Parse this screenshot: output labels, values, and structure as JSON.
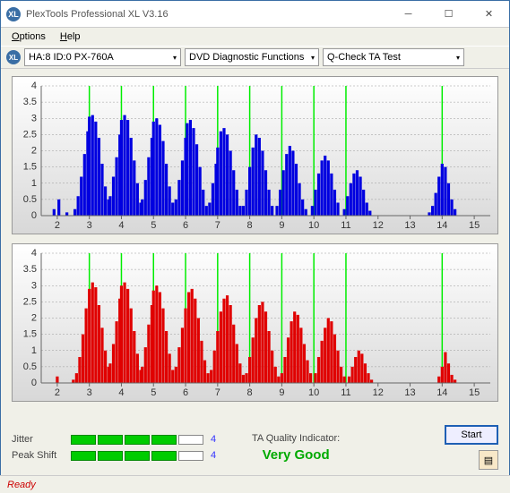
{
  "window": {
    "title": "PlexTools Professional XL V3.16",
    "icon_label": "XL"
  },
  "menu": {
    "options": "Options",
    "help": "Help"
  },
  "toolbar": {
    "device": "HA:8 ID:0   PX-760A",
    "func": "DVD Diagnostic Functions",
    "test": "Q-Check TA Test"
  },
  "metrics": {
    "jitter_label": "Jitter",
    "jitter_value": "4",
    "jitter_bars_filled": 4,
    "peakshift_label": "Peak Shift",
    "peakshift_value": "4",
    "peakshift_bars_filled": 4,
    "ta_label": "TA Quality Indicator:",
    "ta_value": "Very Good"
  },
  "buttons": {
    "start": "Start"
  },
  "status": "Ready",
  "chart_data": [
    {
      "type": "bar",
      "title": "",
      "xlabel": "",
      "ylabel": "",
      "ylim": [
        0,
        4
      ],
      "yticks": [
        0,
        0.5,
        1,
        1.5,
        2,
        2.5,
        3,
        3.5,
        4
      ],
      "xlim": [
        1.5,
        15.5
      ],
      "xticks": [
        2,
        3,
        4,
        5,
        6,
        7,
        8,
        9,
        10,
        11,
        12,
        13,
        14,
        15
      ],
      "vlines": [
        3,
        4,
        5,
        6,
        7,
        8,
        9,
        10,
        11,
        14
      ],
      "color": "#0000e0",
      "points": [
        [
          1.9,
          0.2
        ],
        [
          2.05,
          0.5
        ],
        [
          2.3,
          0.1
        ],
        [
          2.55,
          0.2
        ],
        [
          2.65,
          0.6
        ],
        [
          2.75,
          1.2
        ],
        [
          2.85,
          1.9
        ],
        [
          2.95,
          2.6
        ],
        [
          3.0,
          3.05
        ],
        [
          3.1,
          3.1
        ],
        [
          3.2,
          2.9
        ],
        [
          3.3,
          2.4
        ],
        [
          3.4,
          1.6
        ],
        [
          3.5,
          0.9
        ],
        [
          3.6,
          0.5
        ],
        [
          3.65,
          0.6
        ],
        [
          3.75,
          1.2
        ],
        [
          3.85,
          1.8
        ],
        [
          3.95,
          2.5
        ],
        [
          4.0,
          2.95
        ],
        [
          4.1,
          3.1
        ],
        [
          4.2,
          2.95
        ],
        [
          4.3,
          2.4
        ],
        [
          4.4,
          1.7
        ],
        [
          4.5,
          1.0
        ],
        [
          4.6,
          0.4
        ],
        [
          4.65,
          0.5
        ],
        [
          4.75,
          1.1
        ],
        [
          4.85,
          1.8
        ],
        [
          4.95,
          2.4
        ],
        [
          5.0,
          2.9
        ],
        [
          5.1,
          3.0
        ],
        [
          5.2,
          2.8
        ],
        [
          5.3,
          2.3
        ],
        [
          5.4,
          1.6
        ],
        [
          5.5,
          0.9
        ],
        [
          5.6,
          0.4
        ],
        [
          5.7,
          0.5
        ],
        [
          5.8,
          1.1
        ],
        [
          5.9,
          1.7
        ],
        [
          6.0,
          2.4
        ],
        [
          6.05,
          2.85
        ],
        [
          6.15,
          2.95
        ],
        [
          6.25,
          2.7
        ],
        [
          6.35,
          2.2
        ],
        [
          6.45,
          1.5
        ],
        [
          6.55,
          0.8
        ],
        [
          6.65,
          0.3
        ],
        [
          6.75,
          0.4
        ],
        [
          6.85,
          1.0
        ],
        [
          6.95,
          1.6
        ],
        [
          7.0,
          2.1
        ],
        [
          7.1,
          2.6
        ],
        [
          7.2,
          2.7
        ],
        [
          7.3,
          2.5
        ],
        [
          7.4,
          2.0
        ],
        [
          7.5,
          1.4
        ],
        [
          7.6,
          0.8
        ],
        [
          7.7,
          0.3
        ],
        [
          7.8,
          0.3
        ],
        [
          7.9,
          0.8
        ],
        [
          8.0,
          1.5
        ],
        [
          8.1,
          2.1
        ],
        [
          8.2,
          2.5
        ],
        [
          8.3,
          2.4
        ],
        [
          8.4,
          2.0
        ],
        [
          8.5,
          1.4
        ],
        [
          8.6,
          0.8
        ],
        [
          8.7,
          0.3
        ],
        [
          8.85,
          0.3
        ],
        [
          8.95,
          0.8
        ],
        [
          9.05,
          1.4
        ],
        [
          9.15,
          1.9
        ],
        [
          9.25,
          2.15
        ],
        [
          9.35,
          2.0
        ],
        [
          9.45,
          1.6
        ],
        [
          9.55,
          1.0
        ],
        [
          9.65,
          0.5
        ],
        [
          9.75,
          0.2
        ],
        [
          9.95,
          0.3
        ],
        [
          10.05,
          0.8
        ],
        [
          10.15,
          1.3
        ],
        [
          10.25,
          1.7
        ],
        [
          10.35,
          1.85
        ],
        [
          10.45,
          1.7
        ],
        [
          10.55,
          1.3
        ],
        [
          10.65,
          0.8
        ],
        [
          10.75,
          0.4
        ],
        [
          10.95,
          0.2
        ],
        [
          11.05,
          0.6
        ],
        [
          11.15,
          1.0
        ],
        [
          11.25,
          1.3
        ],
        [
          11.35,
          1.4
        ],
        [
          11.45,
          1.2
        ],
        [
          11.55,
          0.8
        ],
        [
          11.65,
          0.4
        ],
        [
          11.75,
          0.15
        ],
        [
          13.6,
          0.1
        ],
        [
          13.7,
          0.3
        ],
        [
          13.8,
          0.7
        ],
        [
          13.9,
          1.2
        ],
        [
          14.0,
          1.6
        ],
        [
          14.1,
          1.5
        ],
        [
          14.2,
          1.0
        ],
        [
          14.3,
          0.5
        ],
        [
          14.4,
          0.2
        ]
      ]
    },
    {
      "type": "bar",
      "title": "",
      "xlabel": "",
      "ylabel": "",
      "ylim": [
        0,
        4
      ],
      "yticks": [
        0,
        0.5,
        1,
        1.5,
        2,
        2.5,
        3,
        3.5,
        4
      ],
      "xlim": [
        1.5,
        15.5
      ],
      "xticks": [
        2,
        3,
        4,
        5,
        6,
        7,
        8,
        9,
        10,
        11,
        12,
        13,
        14,
        15
      ],
      "vlines": [
        3,
        4,
        5,
        6,
        7,
        8,
        9,
        10,
        11,
        14
      ],
      "color": "#e00000",
      "points": [
        [
          2.0,
          0.2
        ],
        [
          2.5,
          0.1
        ],
        [
          2.6,
          0.3
        ],
        [
          2.7,
          0.8
        ],
        [
          2.8,
          1.5
        ],
        [
          2.9,
          2.3
        ],
        [
          3.0,
          2.9
        ],
        [
          3.1,
          3.1
        ],
        [
          3.2,
          2.95
        ],
        [
          3.3,
          2.4
        ],
        [
          3.4,
          1.7
        ],
        [
          3.5,
          1.0
        ],
        [
          3.6,
          0.5
        ],
        [
          3.65,
          0.6
        ],
        [
          3.75,
          1.2
        ],
        [
          3.85,
          1.9
        ],
        [
          3.95,
          2.6
        ],
        [
          4.0,
          3.0
        ],
        [
          4.1,
          3.1
        ],
        [
          4.2,
          2.9
        ],
        [
          4.3,
          2.3
        ],
        [
          4.4,
          1.6
        ],
        [
          4.5,
          0.9
        ],
        [
          4.6,
          0.4
        ],
        [
          4.65,
          0.5
        ],
        [
          4.75,
          1.1
        ],
        [
          4.85,
          1.8
        ],
        [
          4.95,
          2.4
        ],
        [
          5.0,
          2.85
        ],
        [
          5.1,
          3.0
        ],
        [
          5.2,
          2.8
        ],
        [
          5.3,
          2.3
        ],
        [
          5.4,
          1.6
        ],
        [
          5.5,
          0.9
        ],
        [
          5.6,
          0.4
        ],
        [
          5.7,
          0.5
        ],
        [
          5.8,
          1.1
        ],
        [
          5.9,
          1.7
        ],
        [
          6.0,
          2.3
        ],
        [
          6.1,
          2.8
        ],
        [
          6.2,
          2.9
        ],
        [
          6.3,
          2.6
        ],
        [
          6.4,
          2.0
        ],
        [
          6.5,
          1.3
        ],
        [
          6.6,
          0.7
        ],
        [
          6.7,
          0.3
        ],
        [
          6.8,
          0.4
        ],
        [
          6.9,
          1.0
        ],
        [
          7.0,
          1.6
        ],
        [
          7.1,
          2.2
        ],
        [
          7.2,
          2.6
        ],
        [
          7.3,
          2.7
        ],
        [
          7.4,
          2.4
        ],
        [
          7.5,
          1.8
        ],
        [
          7.6,
          1.2
        ],
        [
          7.7,
          0.6
        ],
        [
          7.8,
          0.25
        ],
        [
          7.9,
          0.3
        ],
        [
          8.0,
          0.8
        ],
        [
          8.1,
          1.4
        ],
        [
          8.2,
          2.0
        ],
        [
          8.3,
          2.4
        ],
        [
          8.4,
          2.5
        ],
        [
          8.5,
          2.2
        ],
        [
          8.6,
          1.6
        ],
        [
          8.7,
          1.0
        ],
        [
          8.8,
          0.5
        ],
        [
          8.9,
          0.2
        ],
        [
          9.0,
          0.3
        ],
        [
          9.1,
          0.8
        ],
        [
          9.2,
          1.4
        ],
        [
          9.3,
          1.9
        ],
        [
          9.4,
          2.2
        ],
        [
          9.5,
          2.1
        ],
        [
          9.6,
          1.7
        ],
        [
          9.7,
          1.2
        ],
        [
          9.8,
          0.7
        ],
        [
          9.9,
          0.3
        ],
        [
          10.05,
          0.3
        ],
        [
          10.15,
          0.8
        ],
        [
          10.25,
          1.3
        ],
        [
          10.35,
          1.7
        ],
        [
          10.45,
          2.0
        ],
        [
          10.55,
          1.9
        ],
        [
          10.65,
          1.5
        ],
        [
          10.75,
          1.0
        ],
        [
          10.85,
          0.5
        ],
        [
          10.95,
          0.2
        ],
        [
          11.1,
          0.2
        ],
        [
          11.2,
          0.5
        ],
        [
          11.3,
          0.8
        ],
        [
          11.4,
          1.0
        ],
        [
          11.5,
          0.9
        ],
        [
          11.6,
          0.6
        ],
        [
          11.7,
          0.3
        ],
        [
          11.8,
          0.1
        ],
        [
          13.9,
          0.2
        ],
        [
          14.0,
          0.5
        ],
        [
          14.1,
          0.95
        ],
        [
          14.2,
          0.6
        ],
        [
          14.3,
          0.25
        ],
        [
          14.4,
          0.1
        ]
      ]
    }
  ]
}
